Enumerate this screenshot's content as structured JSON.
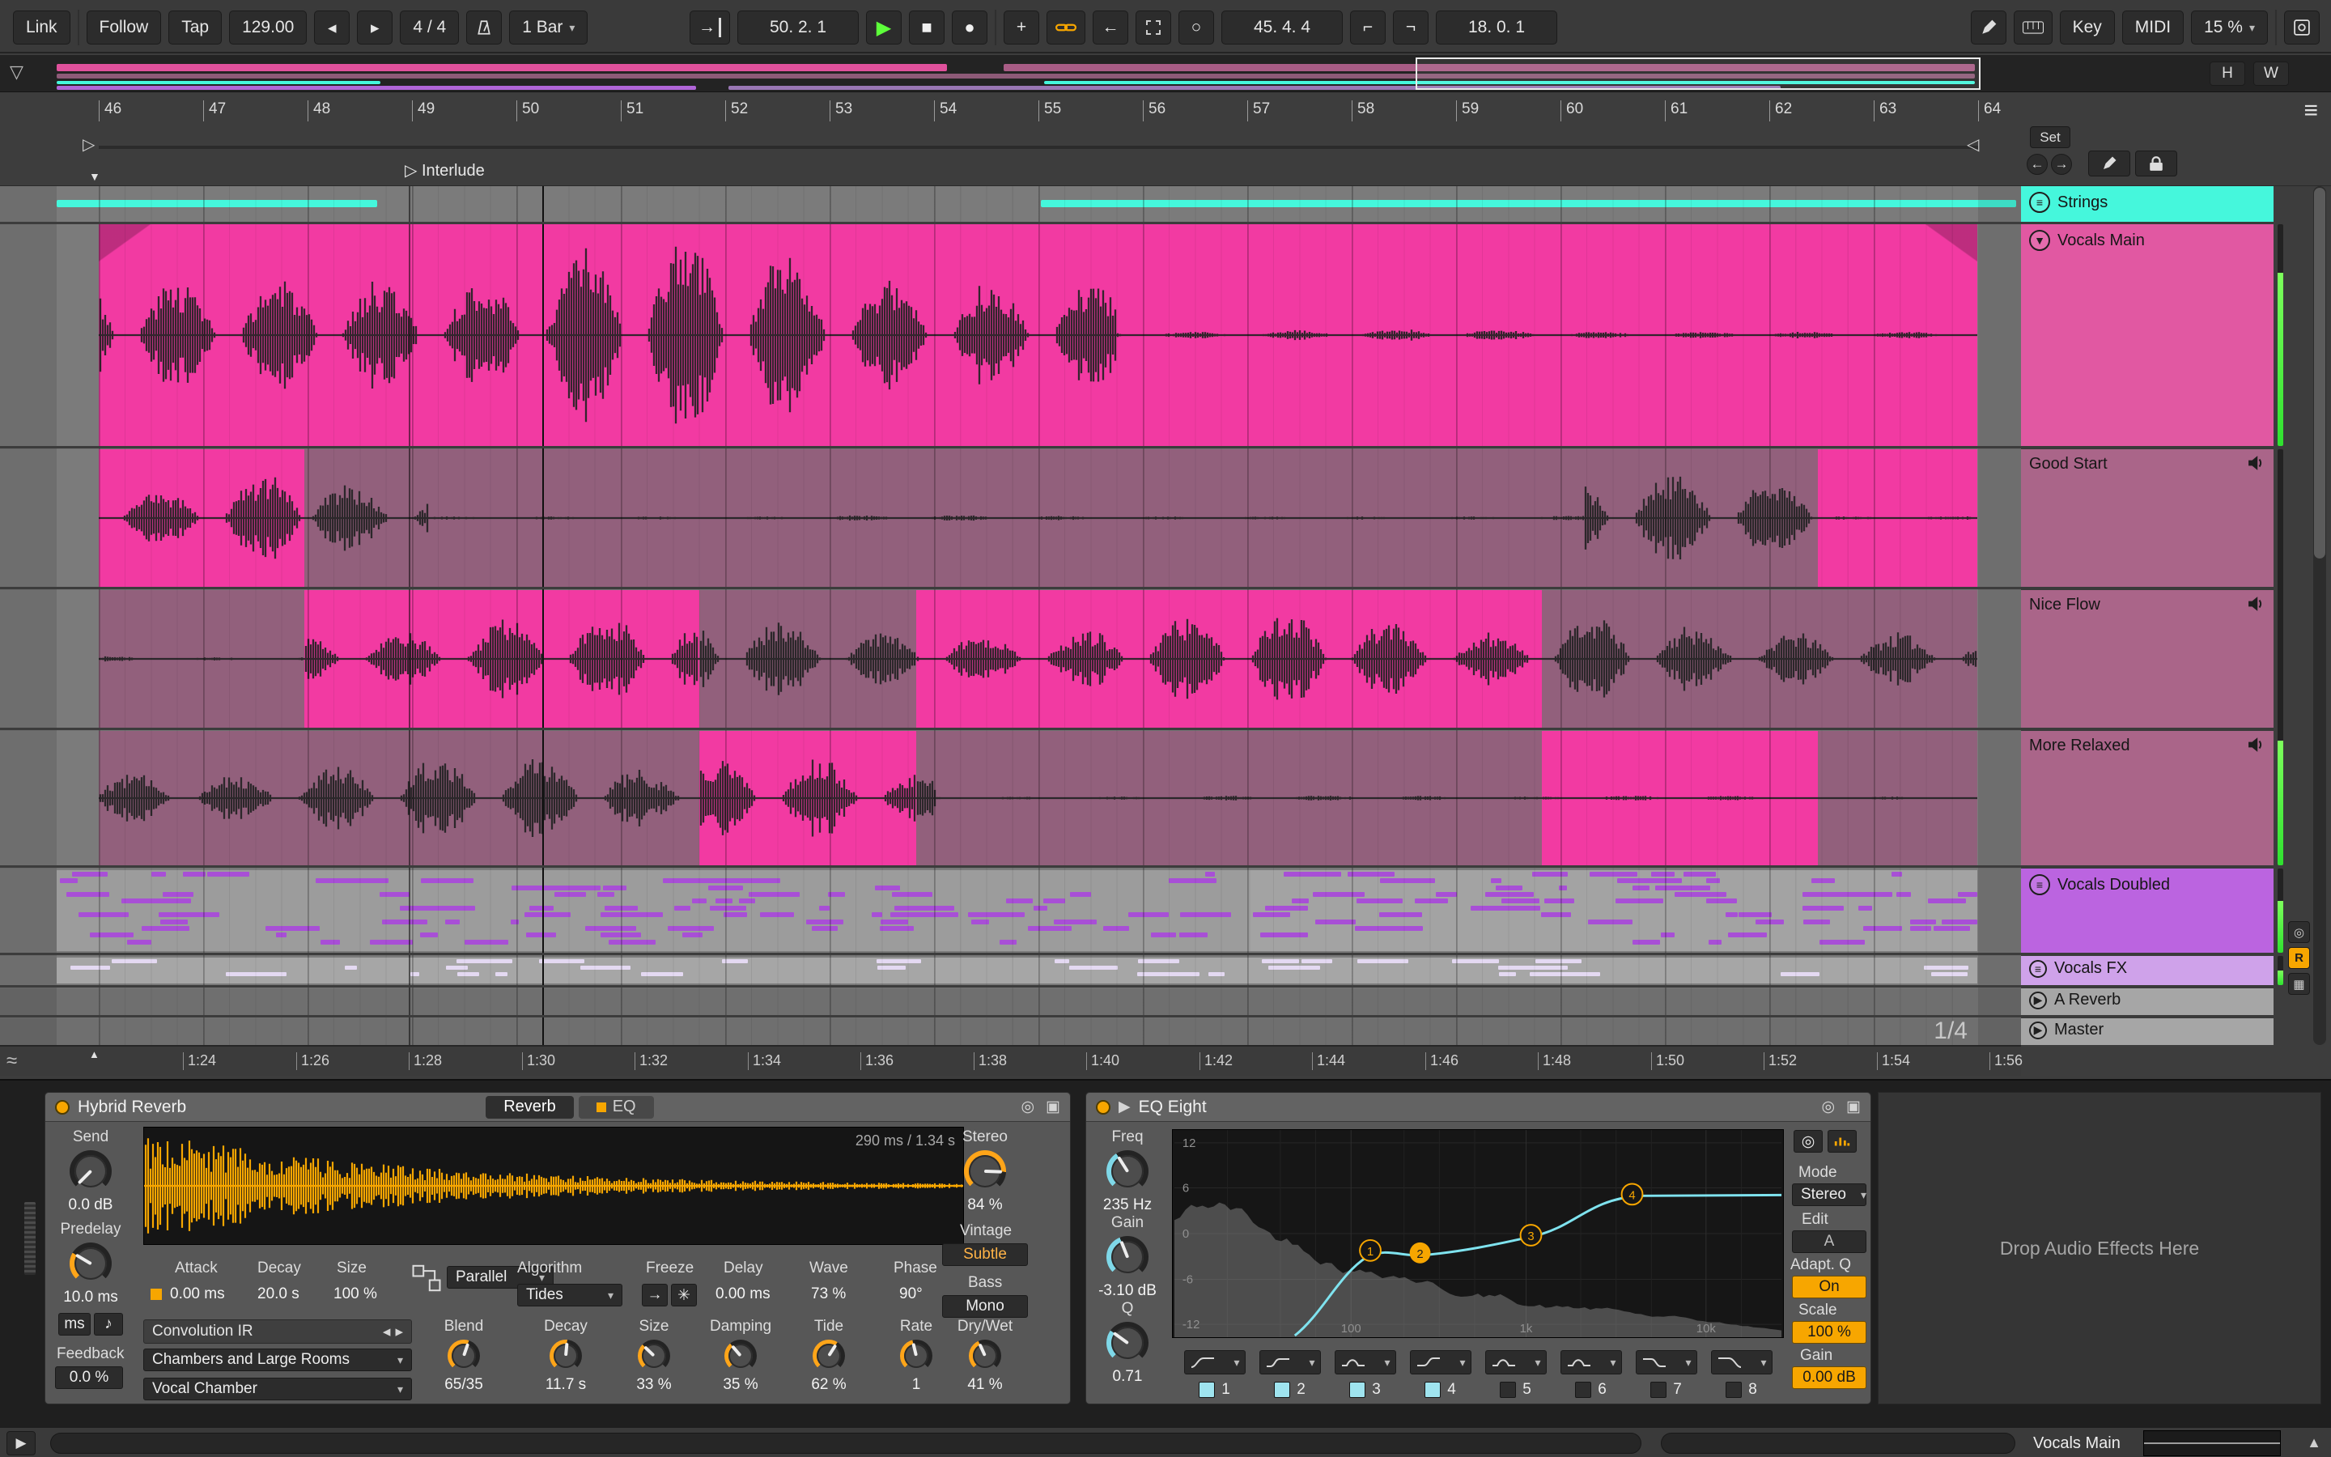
{
  "transport": {
    "link": "Link",
    "follow": "Follow",
    "tap": "Tap",
    "tempo": "129.00",
    "time_sig": "4 / 4",
    "quantize": "1 Bar",
    "position": "50. 2. 1",
    "loop_start": "45. 4. 4",
    "loop_length": "18. 0. 1",
    "key": "Key",
    "midi": "MIDI",
    "cpu": "15 %"
  },
  "overview": {
    "hide": "H",
    "width": "W"
  },
  "ruler": {
    "bars": [
      "46",
      "47",
      "48",
      "49",
      "50",
      "51",
      "52",
      "53",
      "54",
      "55",
      "56",
      "57",
      "58",
      "59",
      "60",
      "61",
      "62",
      "63",
      "64"
    ]
  },
  "locators": {
    "set": "Set",
    "marker": "Interlude"
  },
  "tracks": {
    "strings": "Strings",
    "vocals_main": "Vocals Main",
    "good_start": "Good Start",
    "nice_flow": "Nice Flow",
    "more_relaxed": "More Relaxed",
    "vocals_doubled": "Vocals Doubled",
    "vocals_fx": "Vocals FX",
    "a_reverb": "A Reverb",
    "master": "Master"
  },
  "time_labels": [
    "1:24",
    "1:26",
    "1:28",
    "1:30",
    "1:32",
    "1:34",
    "1:36",
    "1:38",
    "1:40",
    "1:42",
    "1:44",
    "1:46",
    "1:48",
    "1:50",
    "1:52",
    "1:54",
    "1:56"
  ],
  "zoom": "1/4",
  "hybrid": {
    "title": "Hybrid Reverb",
    "tab_reverb": "Reverb",
    "tab_eq": "EQ",
    "ir_time": "290 ms / 1.34 s",
    "send_label": "Send",
    "send_value": "0.0 dB",
    "predelay_label": "Predelay",
    "predelay_value": "10.0 ms",
    "ms": "ms",
    "feedback_label": "Feedback",
    "feedback_value": "0.0 %",
    "attack_label": "Attack",
    "attack_value": "0.00 ms",
    "decay_label": "Decay",
    "decay_value": "20.0 s",
    "size_label": "Size",
    "size_value": "100 %",
    "routing": "Parallel",
    "algorithm_label": "Algorithm",
    "algorithm": "Tides",
    "freeze_label": "Freeze",
    "delay_label": "Delay",
    "delay_value": "0.00 ms",
    "wave_label": "Wave",
    "wave_value": "73 %",
    "phase_label": "Phase",
    "phase_value": "90°",
    "stereo_label": "Stereo",
    "stereo_value": "84 %",
    "vintage_label": "Vintage",
    "vintage_value": "Subtle",
    "bass_label": "Bass",
    "bass_value": "Mono",
    "conv_title": "Convolution IR",
    "ir_category": "Chambers and Large Rooms",
    "ir_file": "Vocal Chamber",
    "blend_label": "Blend",
    "blend_value": "65/35",
    "decay2_label": "Decay",
    "decay2_value": "11.7 s",
    "size2_label": "Size",
    "size2_value": "33 %",
    "damping_label": "Damping",
    "damping_value": "35 %",
    "tide_label": "Tide",
    "tide_value": "62 %",
    "rate_label": "Rate",
    "rate_value": "1",
    "drywet_label": "Dry/Wet",
    "drywet_value": "41 %"
  },
  "eq": {
    "title": "EQ Eight",
    "freq_label": "Freq",
    "freq_value": "235 Hz",
    "gain_label": "Gain",
    "gain_value": "-3.10 dB",
    "q_label": "Q",
    "q_value": "0.71",
    "db_labels": [
      "12",
      "6",
      "0",
      "-6",
      "-12"
    ],
    "freq_labels": [
      "100",
      "1k",
      "10k"
    ],
    "mode_label": "Mode",
    "mode_value": "Stereo",
    "edit_label": "Edit",
    "edit_value": "A",
    "adaptq_label": "Adapt. Q",
    "adaptq_value": "On",
    "scale_label": "Scale",
    "scale_value": "100 %",
    "gain2_label": "Gain",
    "gain2_value": "0.00 dB",
    "bands": [
      "1",
      "2",
      "3",
      "4",
      "5",
      "6",
      "7",
      "8"
    ]
  },
  "drop_zone": "Drop Audio Effects Here",
  "status": {
    "track": "Vocals Main"
  }
}
